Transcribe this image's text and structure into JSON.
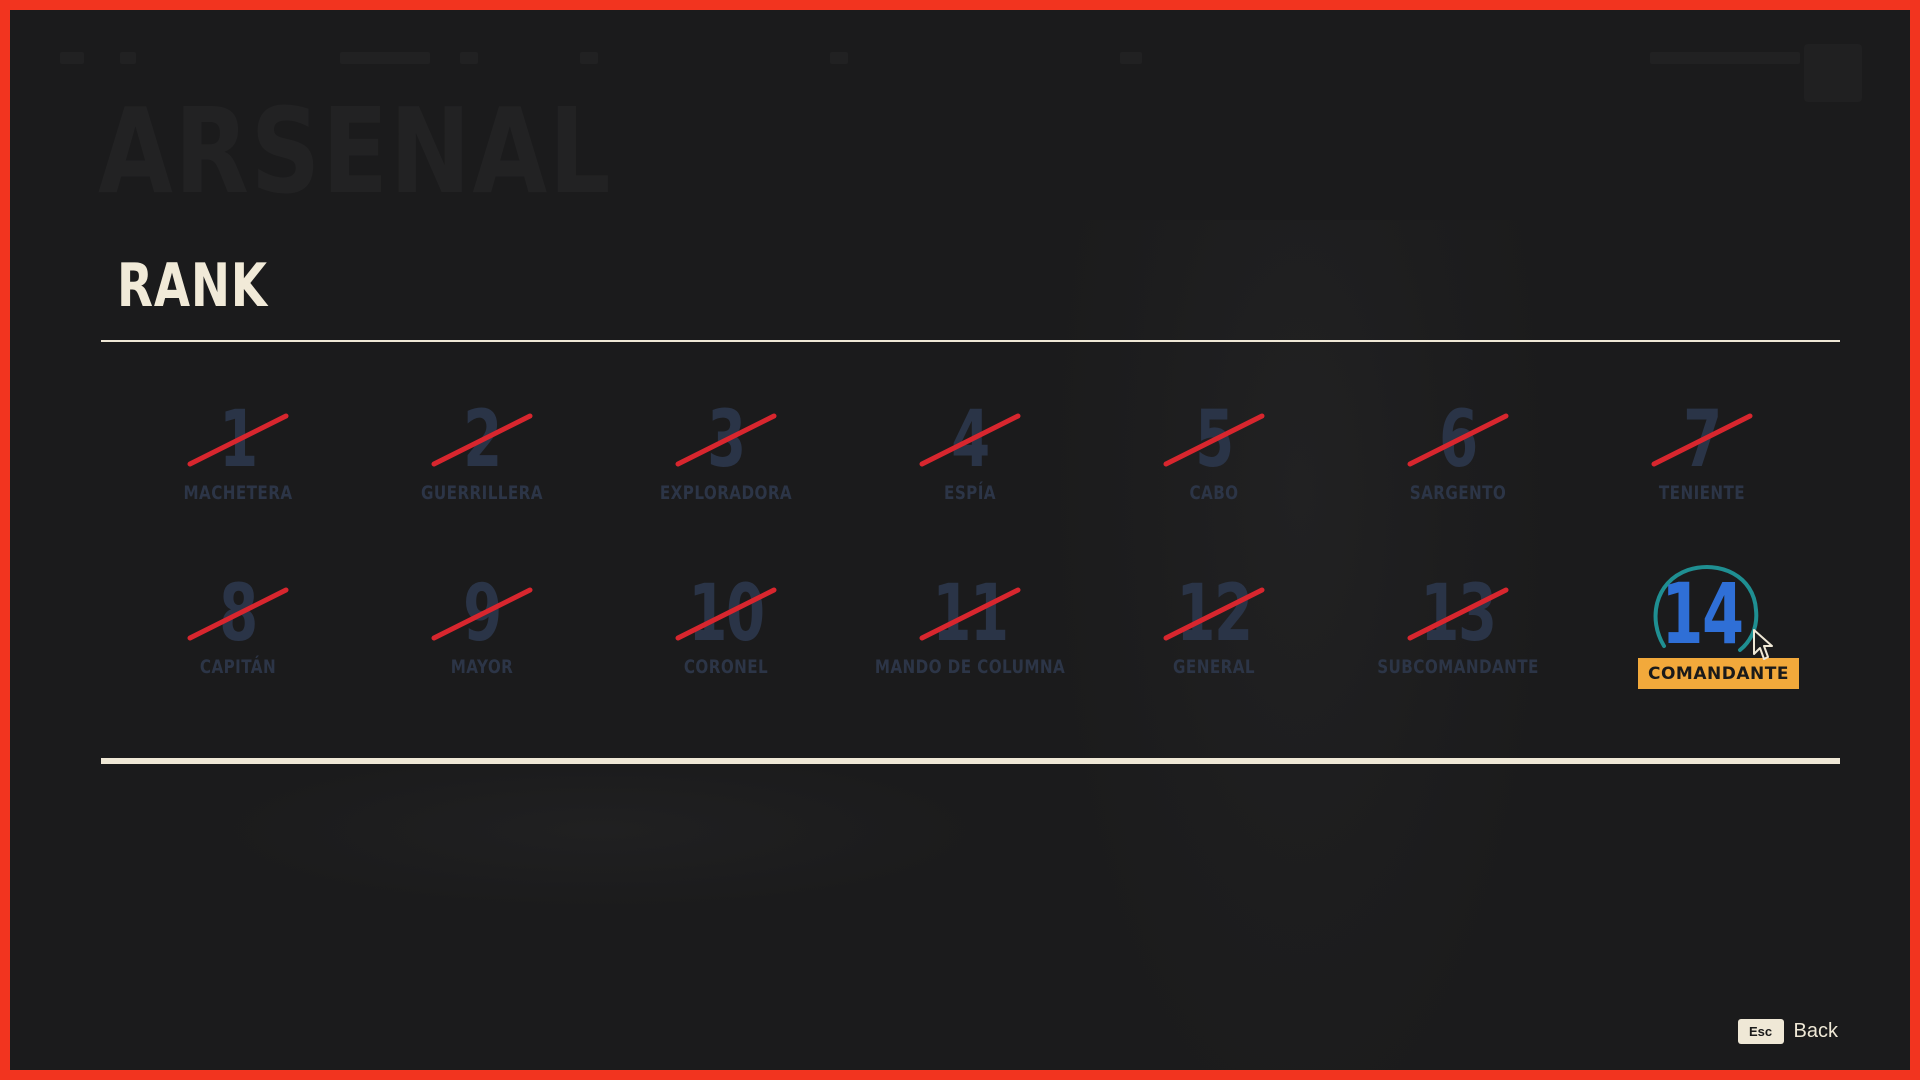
{
  "background": {
    "faction_title": "ARSENAL"
  },
  "rank_panel": {
    "title": "RANK",
    "current_rank": 14,
    "ranks": [
      {
        "number": "1",
        "label": "MACHETERA",
        "completed": true
      },
      {
        "number": "2",
        "label": "GUERRILLERA",
        "completed": true
      },
      {
        "number": "3",
        "label": "EXPLORADORA",
        "completed": true
      },
      {
        "number": "4",
        "label": "ESPÍA",
        "completed": true
      },
      {
        "number": "5",
        "label": "CABO",
        "completed": true
      },
      {
        "number": "6",
        "label": "SARGENTO",
        "completed": true
      },
      {
        "number": "7",
        "label": "TENIENTE",
        "completed": true
      },
      {
        "number": "8",
        "label": "CAPITÁN",
        "completed": true
      },
      {
        "number": "9",
        "label": "MAYOR",
        "completed": true
      },
      {
        "number": "10",
        "label": "CORONEL",
        "completed": true
      },
      {
        "number": "11",
        "label": "MANDO DE COLUMNA",
        "completed": true
      },
      {
        "number": "12",
        "label": "GENERAL",
        "completed": true
      },
      {
        "number": "13",
        "label": "SUBCOMANDANTE",
        "completed": true
      },
      {
        "number": "14",
        "label": "COMANDANTE",
        "completed": false
      }
    ]
  },
  "footer": {
    "esc_key": "Esc",
    "back_label": "Back"
  },
  "colors": {
    "frame_border": "#f2341f",
    "background": "#1b1b1c",
    "cream": "#efe8d6",
    "rank_dim": "#2a3447",
    "strike_red": "#d8262e",
    "current_blue": "#2f6fd6",
    "current_ring": "#1f8f92",
    "current_badge": "#f2a93b"
  },
  "icons": {
    "strike": "red-slash-icon",
    "ring": "teal-circle-icon",
    "cursor": "mouse-pointer-icon"
  }
}
